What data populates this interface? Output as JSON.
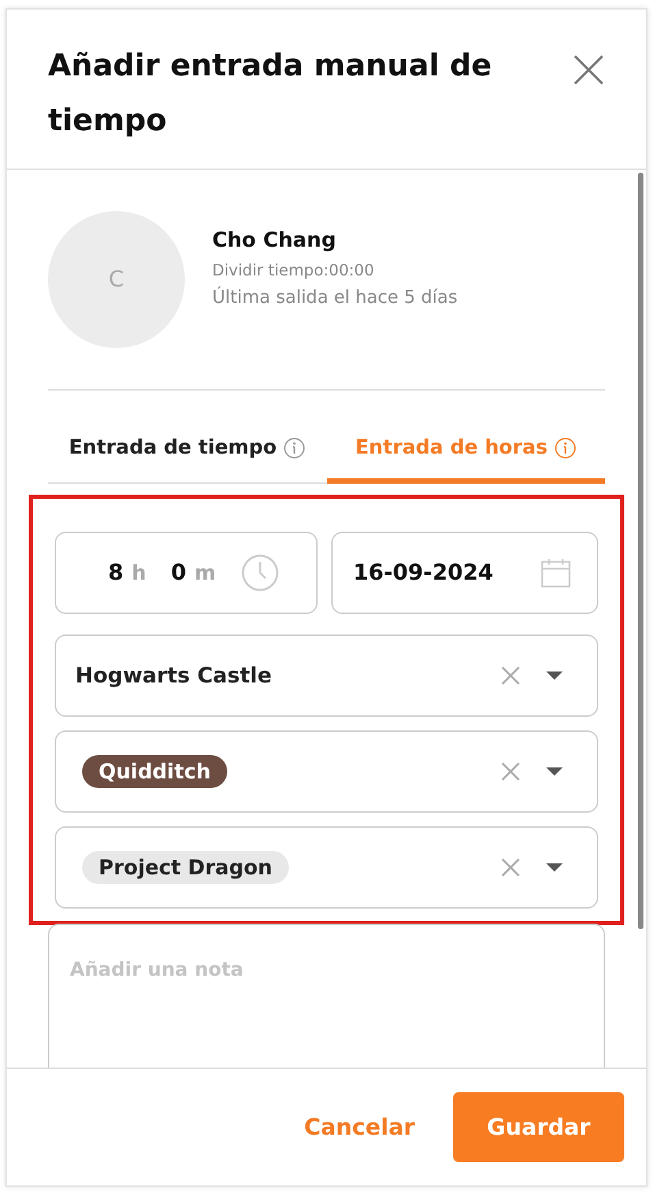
{
  "title": "Añadir entrada manual de tiempo",
  "user": {
    "initial": "C",
    "name": "Cho Chang",
    "split_time": "Dividir tiempo:00:00",
    "last_out": "Última salida el hace 5 días"
  },
  "tabs": [
    {
      "label": "Entrada de tiempo",
      "selected": false
    },
    {
      "label": "Entrada de horas",
      "selected": true
    }
  ],
  "duration": {
    "hours": "8",
    "hours_unit": "h",
    "minutes": "0",
    "minutes_unit": "m"
  },
  "date": "16-09-2024",
  "selects": [
    {
      "kind": "text",
      "value": "Hogwarts Castle"
    },
    {
      "kind": "tag",
      "value": "Quidditch",
      "color": "#6d4c41"
    },
    {
      "kind": "tag",
      "value": "Project Dragon",
      "color": "#e8e8e8"
    }
  ],
  "note": {
    "placeholder": "Añadir una nota"
  },
  "buttons": {
    "cancel": "Cancelar",
    "save": "Guardar"
  }
}
